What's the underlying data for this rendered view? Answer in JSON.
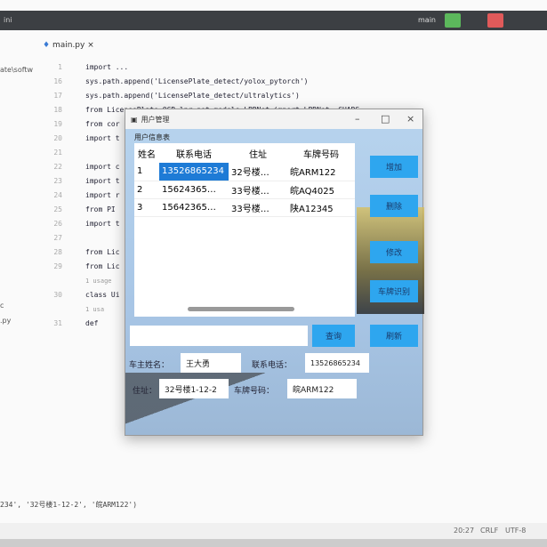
{
  "ide": {
    "title": "ini",
    "run_config": "main",
    "sidebar": [
      "ate\\softw",
      "c",
      ".py"
    ],
    "tab": "main.py",
    "code": [
      {
        "n": "1",
        "t": "import ..."
      },
      {
        "n": "16",
        "t": "sys.path.append('LicensePlate_detect/yolox_pytorch')"
      },
      {
        "n": "17",
        "t": "sys.path.append('LicensePlate_detect/ultralytics')"
      },
      {
        "n": "18",
        "t": "from LicensePlate_OCR.lpr_net.models.LPRNet import LPRNet, CHARS"
      },
      {
        "n": "19",
        "t": "from cor"
      },
      {
        "n": "20",
        "t": "import t"
      },
      {
        "n": "21",
        "t": ""
      },
      {
        "n": "22",
        "t": "import c"
      },
      {
        "n": "23",
        "t": "import t"
      },
      {
        "n": "24",
        "t": "import r"
      },
      {
        "n": "25",
        "t": "from PI"
      },
      {
        "n": "26",
        "t": "import t"
      },
      {
        "n": "27",
        "t": ""
      },
      {
        "n": "28",
        "t": "from Lic"
      },
      {
        "n": "29",
        "t": "from Lic"
      },
      {
        "n": "",
        "t": "1 usage",
        "hint": true
      },
      {
        "n": "30",
        "t": "class Ui"
      },
      {
        "n": "",
        "t": "    1 usa",
        "hint": true
      },
      {
        "n": "31",
        "t": "  def"
      }
    ],
    "output": "234', '32号楼1-12-2', '皖ARM122')",
    "status": {
      "pos": "20:27",
      "eol": "CRLF",
      "enc": "UTF-8"
    }
  },
  "dialog": {
    "title": "用户管理",
    "group": "用户信息表",
    "headers": [
      "姓名",
      "联系电话",
      "住址",
      "车牌号码"
    ],
    "rows": [
      [
        "1",
        "13526865234",
        "32号楼…",
        "皖ARM122"
      ],
      [
        "2",
        "15624365…",
        "33号楼…",
        "皖AQ4025"
      ],
      [
        "3",
        "15642365…",
        "33号楼…",
        "陕A12345"
      ]
    ],
    "buttons": {
      "add": "增加",
      "delete": "删除",
      "modify": "修改",
      "recognize": "车牌识别",
      "query": "查询",
      "refresh": "刷新"
    },
    "search_value": "",
    "form": {
      "name_label": "车主姓名：",
      "name": "王大勇",
      "phone_label": "联系电话：",
      "phone": "13526865234",
      "addr_label": "住址：",
      "addr": "32号楼1-12-2",
      "plate_label": "车牌号码：",
      "plate": "皖ARM122"
    }
  }
}
